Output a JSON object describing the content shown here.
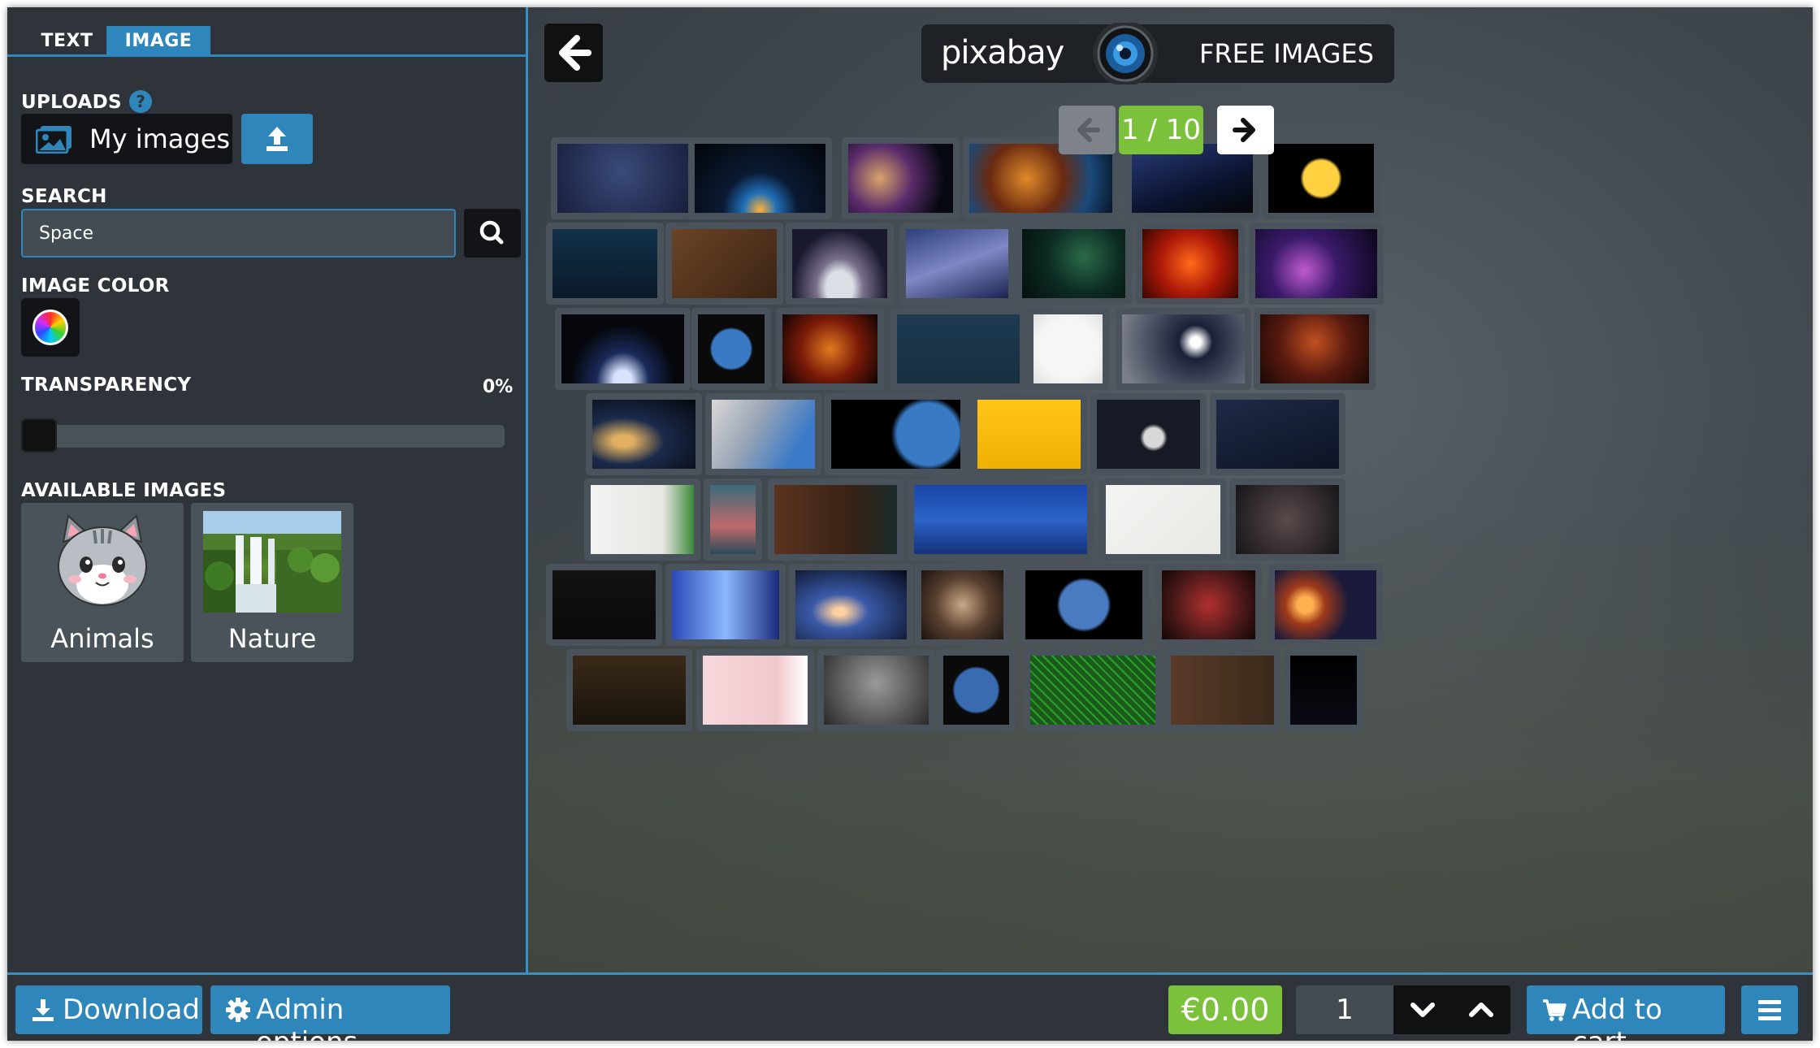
{
  "tabs": [
    {
      "label": "TEXT"
    },
    {
      "label": "IMAGE"
    }
  ],
  "uploads": {
    "label": "UPLOADS",
    "help": "?",
    "my_images_label": "My images"
  },
  "search": {
    "label": "SEARCH",
    "value": "Space"
  },
  "image_color": {
    "label": "IMAGE COLOR"
  },
  "transparency": {
    "label": "TRANSPARENCY",
    "value": "0%",
    "level": 0
  },
  "available": {
    "label": "AVAILABLE IMAGES",
    "items": [
      {
        "label": "Animals"
      },
      {
        "label": "Nature"
      }
    ]
  },
  "pixabay": {
    "logo": "pixabay",
    "tagline": "FREE IMAGES"
  },
  "pagination": {
    "indicator": "1 / 10"
  },
  "bottom": {
    "download_label": "Download",
    "admin_label": "Admin options",
    "price": "€0.00",
    "quantity": "1",
    "cart_label": "Add to cart"
  },
  "colors": {
    "accent": "#2f86bb",
    "green": "#7cc13b",
    "panel": "#2f343b"
  },
  "icons": [
    "help-icon",
    "images-icon",
    "upload-icon",
    "search-icon",
    "color-wheel-icon",
    "arrow-left-icon",
    "arrow-right-icon",
    "download-icon",
    "gear-icon",
    "chevron-down-icon",
    "chevron-up-icon",
    "cart-icon",
    "menu-icon"
  ]
}
